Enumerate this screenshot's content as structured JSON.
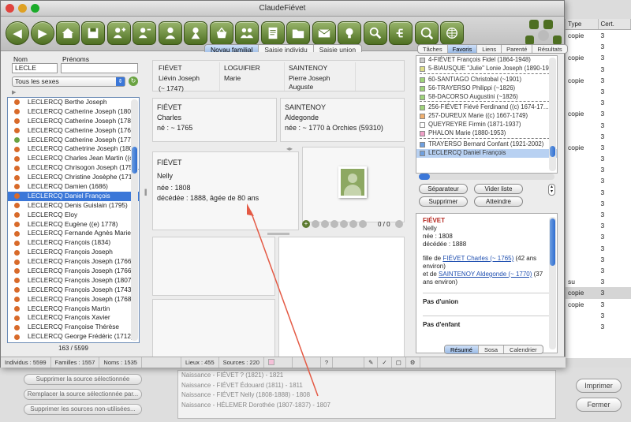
{
  "window": {
    "title": "ClaudeFiévet"
  },
  "background": {
    "right_headers": [
      "Type",
      "Cert."
    ],
    "right_rows": [
      {
        "a": "copie",
        "b": "3"
      },
      {
        "a": "",
        "b": "3"
      },
      {
        "a": "copie",
        "b": "3"
      },
      {
        "a": "",
        "b": "3"
      },
      {
        "a": "copie",
        "b": "3"
      },
      {
        "a": "",
        "b": "3"
      },
      {
        "a": "",
        "b": "3"
      },
      {
        "a": "copie",
        "b": "3"
      },
      {
        "a": "",
        "b": "3"
      },
      {
        "a": "",
        "b": "3"
      },
      {
        "a": "copie",
        "b": "3"
      },
      {
        "a": "",
        "b": "3"
      },
      {
        "a": "",
        "b": "3"
      },
      {
        "a": "",
        "b": "3"
      },
      {
        "a": "",
        "b": "3"
      },
      {
        "a": "",
        "b": "3"
      },
      {
        "a": "",
        "b": "3"
      },
      {
        "a": "",
        "b": "3"
      },
      {
        "a": "",
        "b": "3"
      },
      {
        "a": "",
        "b": "3"
      },
      {
        "a": "",
        "b": "3"
      },
      {
        "a": "",
        "b": "3"
      },
      {
        "a": "su",
        "b": "3"
      },
      {
        "a": "copie",
        "b": "3"
      },
      {
        "a": "copie",
        "b": "3"
      },
      {
        "a": "",
        "b": "3"
      },
      {
        "a": "",
        "b": "3"
      }
    ],
    "buttons": [
      "Supprimer la source sélectionnée",
      "Remplacer la source sélectionnée par...",
      "Supprimer les sources non-utilisées..."
    ],
    "print_button": "Imprimer",
    "close_button": "Fermer",
    "sources": [
      "Naissance - FIÉVET ? (1821) - 1821",
      "Naissance - FIÉVET Édouard (1811) - 1811",
      "Naissance - FIÉVET Nelly (1808-1888) - 1808",
      "Naissance - HÉLEMER Dorothée (1807-1837) - 1807"
    ]
  },
  "search": {
    "nom_label": "Nom",
    "prenoms_label": "Prénoms",
    "nom_value": "LECLE",
    "prenoms_value": "",
    "sex_filter": "Tous les sexes",
    "count": "163 / 5599"
  },
  "persons": [
    {
      "name": "LECLERCQ Berthe Joseph",
      "g": "m"
    },
    {
      "name": "LECLERCQ Catherine Joseph (1803)",
      "g": "f"
    },
    {
      "name": "LECLERCQ Catherine Joseph (1787)",
      "g": "f"
    },
    {
      "name": "LECLERCQ Catherine Joseph (1766)",
      "g": "f"
    },
    {
      "name": "LECLERCQ Catherine Joseph (1772-...",
      "g": "g"
    },
    {
      "name": "LECLERCQ Cathetrine Joseph (1802...",
      "g": "f"
    },
    {
      "name": "LECLERCQ Charles Jean Martin ((c) ...",
      "g": "f"
    },
    {
      "name": "LECLERCQ Chrisogon Joseph (1757...",
      "g": "f"
    },
    {
      "name": "LECLERCQ Christine Josèphe (1717)",
      "g": "f"
    },
    {
      "name": "LECLERCQ Damien (1686)",
      "g": "f"
    },
    {
      "name": "LECLERCQ Daniel François",
      "g": "f",
      "sel": true
    },
    {
      "name": "LECLERCQ Denis Guislain (1795)",
      "g": "f"
    },
    {
      "name": "LECLERCQ Eloy",
      "g": "f"
    },
    {
      "name": "LECLERCQ Eugène ((e) 1778)",
      "g": "f"
    },
    {
      "name": "LECLERCQ Fernande  Agnès  Marie",
      "g": "f"
    },
    {
      "name": "LECLERCQ François (1834)",
      "g": "f"
    },
    {
      "name": "LECLERCQ François Joseph",
      "g": "f"
    },
    {
      "name": "LECLERCQ François Joseph (1766)",
      "g": "f"
    },
    {
      "name": "LECLERCQ François Joseph (1766)",
      "g": "f"
    },
    {
      "name": "LECLERCQ François Joseph (1807)",
      "g": "f"
    },
    {
      "name": "LECLERCQ François Joseph (1743)",
      "g": "f"
    },
    {
      "name": "LECLERCQ François Joseph (1768)",
      "g": "f"
    },
    {
      "name": "LECLERCQ François Martin",
      "g": "f"
    },
    {
      "name": "LECLERCQ François Xavier",
      "g": "f"
    },
    {
      "name": "LECLERCQ Françoise Thérèse",
      "g": "f"
    },
    {
      "name": "LECLERCQ George Frédéric (1712)",
      "g": "f"
    }
  ],
  "tabs": {
    "center": [
      "Noyau familial",
      "Saisie individu",
      "Saisie union"
    ],
    "right": [
      "Tâches",
      "Favoris",
      "Liens",
      "Parenté",
      "Résultats"
    ],
    "bottom": [
      "Résumé",
      "Sosa",
      "Calendrier"
    ]
  },
  "grandparents": [
    {
      "surname": "FIÉVET",
      "given": "Liévin Joseph",
      "dates": "(~ 1747)"
    },
    {
      "surname": "LOGUIFIER",
      "given": "Marie",
      "dates": ""
    },
    {
      "surname": "SAINTENOY",
      "given": "Pierre Joseph Auguste",
      "dates": ""
    },
    {
      "surname": "",
      "given": "",
      "dates": ""
    }
  ],
  "father": {
    "surname": "FIÉVET",
    "given": "Charles",
    "info": "né : ~ 1765"
  },
  "mother": {
    "surname": "SAINTENOY",
    "given": "Aldegonde",
    "info": "née : ~ 1770 à Orchies (59310)"
  },
  "focus": {
    "surname": "FIÉVET",
    "given": "Nelly",
    "born": "née : 1808",
    "died": "décédée : 1888, âgée de 80 ans"
  },
  "photo_counter": "0 / 0",
  "favorites": [
    {
      "t": "4-FIÉVET François Fidel (1864-1948)",
      "c": "#cccccc"
    },
    {
      "t": "5-BIAUSQUE \"Julie\" Lonie Joseph (1890-19...",
      "c": "#dddd88"
    },
    {
      "sep": true
    },
    {
      "t": "60-SANTIAGO Christobal (~1901)",
      "c": "#9fd47a"
    },
    {
      "t": "56-TRAYERSO Philippi (~1826)",
      "c": "#9fd47a"
    },
    {
      "t": "58-DACORSO Augustini (~1826)",
      "c": "#9fd47a"
    },
    {
      "sep": true
    },
    {
      "t": "256-FIÉVET Fiévé Ferdinand ((c) 1674-17...",
      "c": "#9fd47a"
    },
    {
      "t": "257-DUREUX Marie ((c) 1667-1749)",
      "c": "#f0b070"
    },
    {
      "t": "QUEYREYRE Firmin (1871-1937)",
      "c": "#ffffff"
    },
    {
      "t": "PHALON Marie (1880-1953)",
      "c": "#f0a0c8"
    },
    {
      "sep": true
    },
    {
      "t": "TRAYERSO Bernard Confant (1921-2002)",
      "c": "#6fa0e0"
    },
    {
      "t": "LECLERCQ Daniel François",
      "c": "#6fa0e0",
      "sel": true
    }
  ],
  "fav_buttons": {
    "separator": "Séparateur",
    "clear": "Vider liste",
    "delete": "Supprimer",
    "goto": "Atteindre"
  },
  "summary": {
    "name_surname": "FIÉVET",
    "given": "Nelly",
    "born": "née : 1808",
    "died": "décédée : 1888",
    "daughter_of": "fille de",
    "father_link": "FIÉVET Charles (~ 1765)",
    "father_age": "(42 ans environ)",
    "and_of": "et de",
    "mother_link": "SAINTENOY Aldegonde (~ 1770)",
    "mother_age": "(37 ans environ)",
    "no_union": "Pas d'union",
    "no_child": "Pas d'enfant"
  },
  "status": {
    "individus": "Individus : 5599",
    "familles": "Familles : 1557",
    "noms": "Noms : 1535",
    "lieux": "Lieux : 455",
    "sources": "Sources : 220"
  }
}
